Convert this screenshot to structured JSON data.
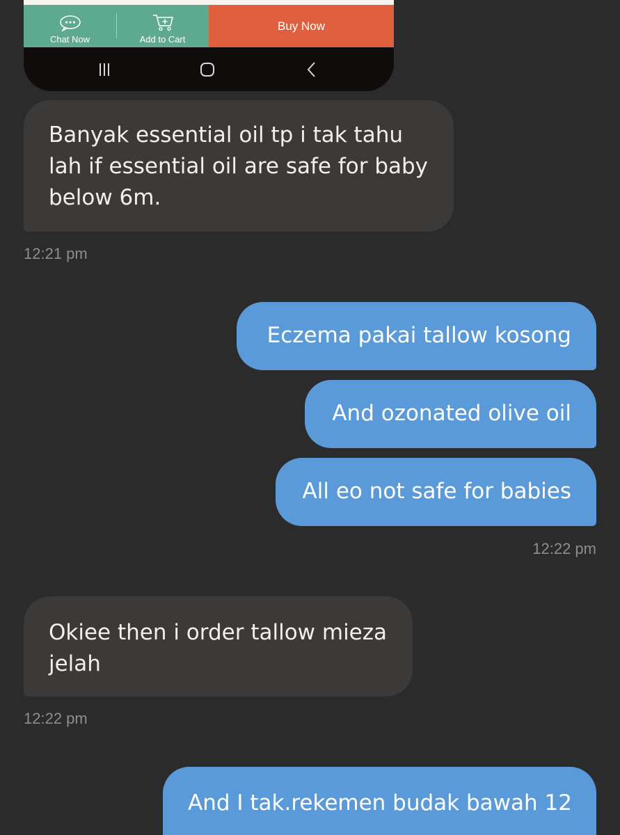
{
  "product_bar": {
    "chat_now_label": "Chat Now",
    "add_to_cart_label": "Add to Cart",
    "buy_now_label": "Buy Now",
    "colors": {
      "left_bg": "#5daa90",
      "buy_bg": "#e0603d"
    }
  },
  "android_nav": {
    "recent_icon": "recent-apps-icon",
    "home_icon": "home-icon",
    "back_icon": "back-icon"
  },
  "messages": [
    {
      "side": "in",
      "lines": [
        "Banyak essential oil tp i tak tahu",
        "lah if essential oil are safe for baby",
        "below 6m."
      ],
      "time": "12:21 pm"
    },
    {
      "side": "out",
      "lines": [
        "Eczema pakai tallow kosong"
      ]
    },
    {
      "side": "out",
      "lines": [
        "And ozonated olive oil"
      ]
    },
    {
      "side": "out",
      "lines": [
        "All eo not safe for babies"
      ],
      "time": "12:22 pm"
    },
    {
      "side": "in",
      "lines": [
        "Okiee then i order tallow mieza",
        "jelah"
      ],
      "time": "12:22 pm"
    },
    {
      "side": "out",
      "lines": [
        "And I tak.rekemen budak bawah 12"
      ]
    }
  ],
  "colors": {
    "background": "#2b2b2c",
    "incoming_bubble": "#3b3a39",
    "outgoing_bubble": "#5b9ad8",
    "timestamp": "#8e8e8e"
  }
}
